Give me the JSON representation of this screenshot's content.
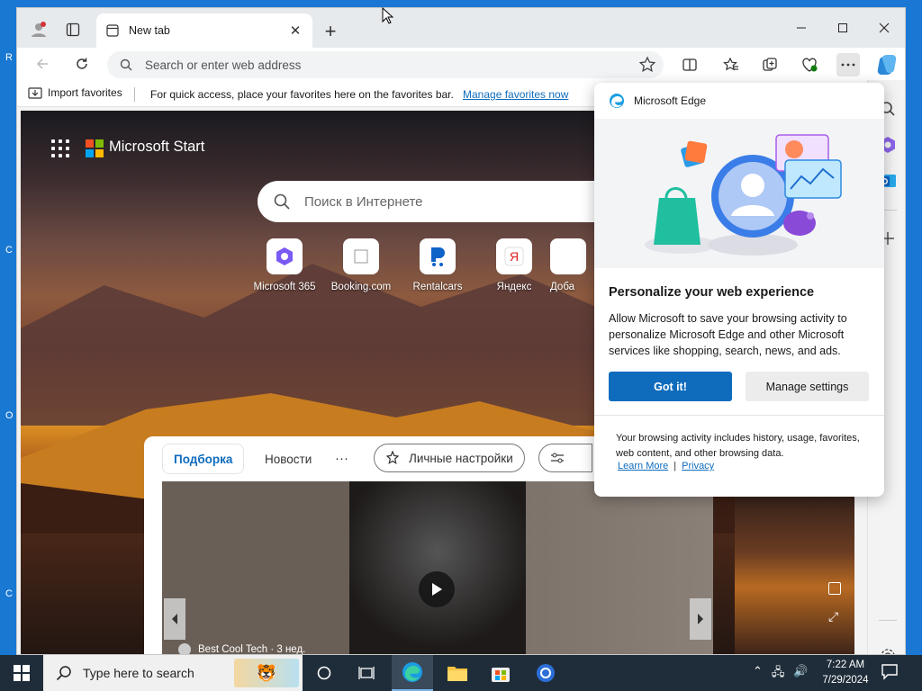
{
  "desktop": {
    "edge_letters": [
      "R",
      "C",
      "O",
      "C"
    ]
  },
  "browser": {
    "tab": {
      "title": "New tab"
    },
    "address": {
      "placeholder": "Search or enter web address"
    },
    "favorites_bar": {
      "import_label": "Import favorites",
      "tip": "For quick access, place your favorites here on the favorites bar.",
      "manage_link": "Manage favorites now"
    }
  },
  "start_page": {
    "brand": "Microsoft Start",
    "search_placeholder": "Поиск в Интернете",
    "quick_links": [
      {
        "label": "Microsoft 365",
        "icon": "m365-icon"
      },
      {
        "label": "Booking.com",
        "icon": "booking-icon"
      },
      {
        "label": "Rentalcars",
        "icon": "rentalcars-icon"
      },
      {
        "label": "Яндекс",
        "icon": "yandex-icon"
      },
      {
        "label": "Доба",
        "icon": "add-icon"
      }
    ],
    "feed": {
      "tabs": [
        "Подборка",
        "Новости"
      ],
      "more": "···",
      "personal": "Личные настройки",
      "source": "Best Cool Tech · 3 нед."
    }
  },
  "popup": {
    "header": "Microsoft Edge",
    "title": "Personalize your web experience",
    "body": "Allow Microsoft to save your browsing activity to personalize Microsoft Edge and other Microsoft services like shopping, search, news, and ads.",
    "primary_button": "Got it!",
    "secondary_button": "Manage settings",
    "footer": "Your browsing activity includes history, usage, favorites, web content, and other browsing data.",
    "learn_more": "Learn More",
    "link_separator": "|",
    "privacy": "Privacy"
  },
  "taskbar": {
    "search_placeholder": "Type here to search",
    "time": "7:22 AM",
    "date": "7/29/2024"
  },
  "colors": {
    "accent": "#0f6cbd",
    "taskbar": "#1f2d3a",
    "desktop": "#1a78d4"
  }
}
